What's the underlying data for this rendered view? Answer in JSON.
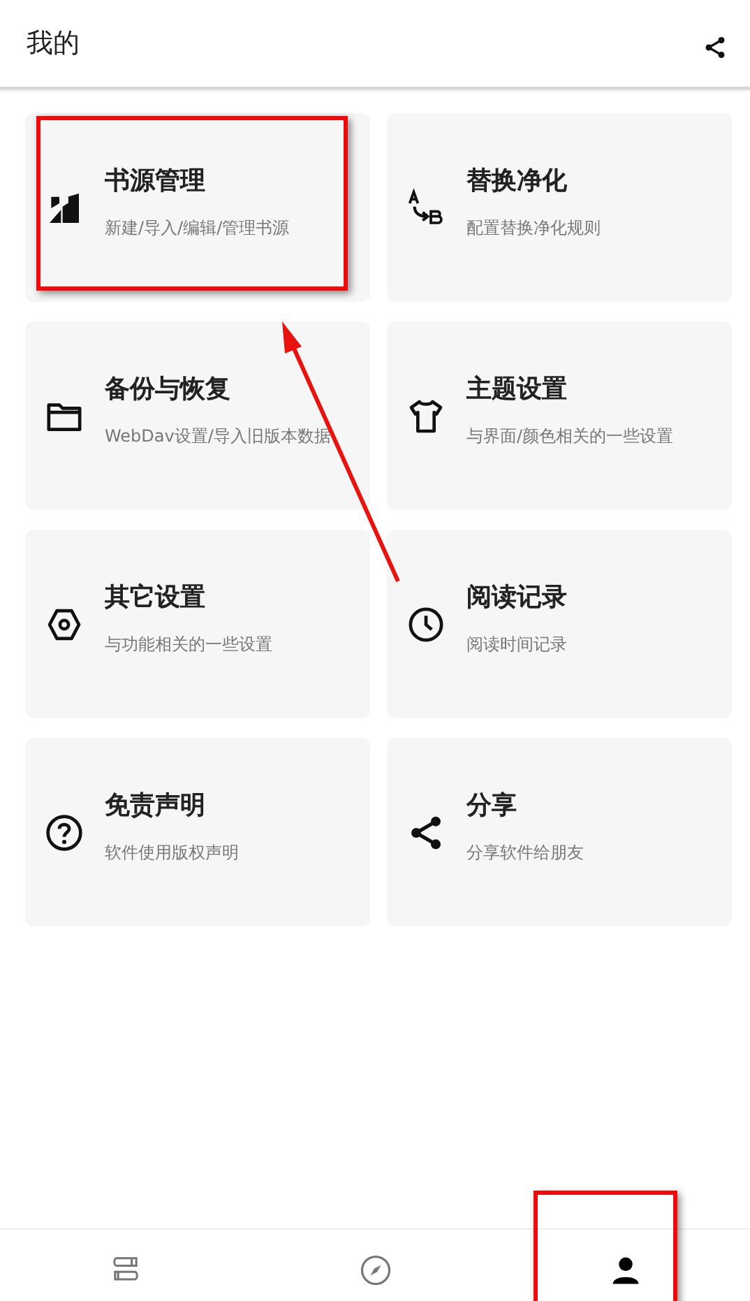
{
  "header": {
    "title": "我的",
    "share_icon": true
  },
  "tiles": [
    {
      "kind": "sources",
      "title": "书源管理",
      "subtitle": "新建/导入/编辑/管理书源",
      "highlighted": true
    },
    {
      "kind": "replace",
      "title": "替换净化",
      "subtitle": "配置替换净化规则",
      "highlighted": false
    },
    {
      "kind": "backup",
      "title": "备份与恢复",
      "subtitle": "WebDav设置/导入旧版本数据",
      "highlighted": false
    },
    {
      "kind": "theme",
      "title": "主题设置",
      "subtitle": "与界面/颜色相关的一些设置",
      "highlighted": false
    },
    {
      "kind": "other",
      "title": "其它设置",
      "subtitle": "与功能相关的一些设置",
      "highlighted": false
    },
    {
      "kind": "history",
      "title": "阅读记录",
      "subtitle": "阅读时间记录",
      "highlighted": false
    },
    {
      "kind": "disclaimer",
      "title": "免责声明",
      "subtitle": "软件使用版权声明",
      "highlighted": false
    },
    {
      "kind": "share",
      "title": "分享",
      "subtitle": "分享软件给朋友",
      "highlighted": false
    }
  ],
  "annotation_arrow": true,
  "bottom_nav": [
    {
      "kind": "bookshelf",
      "selected": false,
      "highlighted": false
    },
    {
      "kind": "discover",
      "selected": false,
      "highlighted": false
    },
    {
      "kind": "profile",
      "selected": true,
      "highlighted": true
    }
  ]
}
